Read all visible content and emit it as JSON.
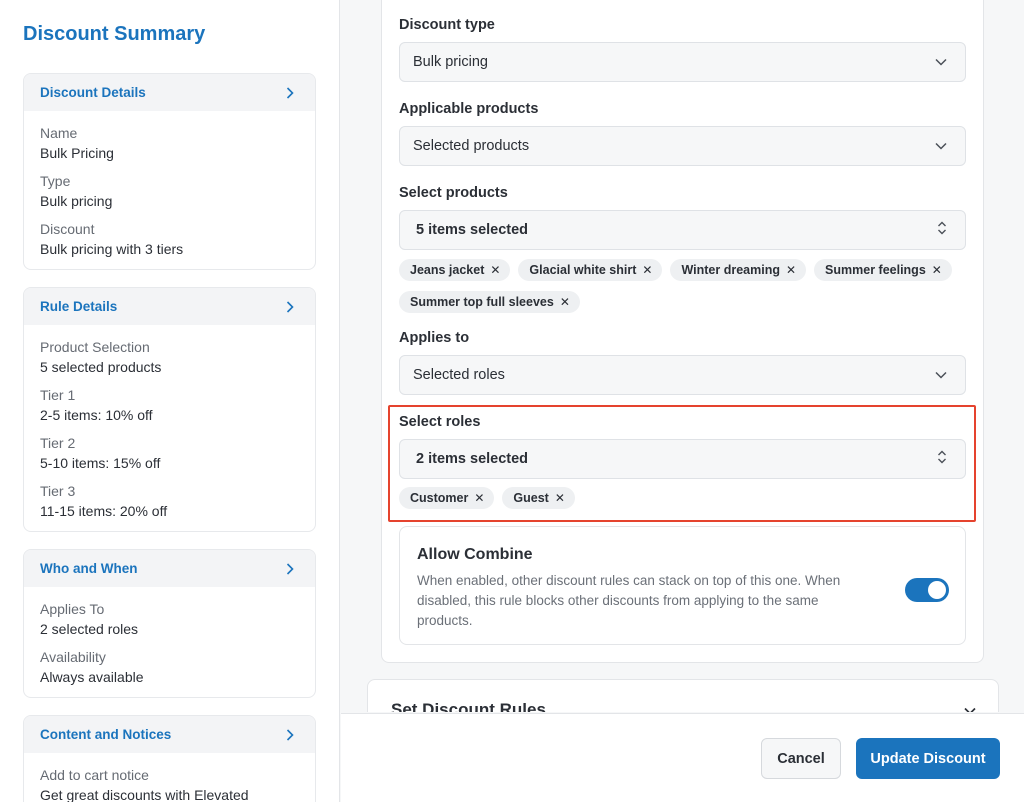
{
  "sidebar": {
    "title": "Discount Summary",
    "cards": {
      "details": {
        "heading": "Discount Details",
        "fields": [
          {
            "label": "Name",
            "value": "Bulk Pricing"
          },
          {
            "label": "Type",
            "value": "Bulk pricing"
          },
          {
            "label": "Discount",
            "value": "Bulk pricing with 3 tiers"
          }
        ]
      },
      "rules": {
        "heading": "Rule Details",
        "fields": [
          {
            "label": "Product Selection",
            "value": "5 selected products"
          },
          {
            "label": "Tier 1",
            "value": "2-5 items: 10% off"
          },
          {
            "label": "Tier 2",
            "value": "5-10 items: 15% off"
          },
          {
            "label": "Tier 3",
            "value": "11-15 items: 20% off"
          }
        ]
      },
      "who": {
        "heading": "Who and When",
        "fields": [
          {
            "label": "Applies To",
            "value": "2 selected roles"
          },
          {
            "label": "Availability",
            "value": "Always available"
          }
        ]
      },
      "content": {
        "heading": "Content and Notices",
        "fields": [
          {
            "label": "Add to cart notice",
            "value": "Get great discounts with Elevated"
          }
        ]
      }
    }
  },
  "form": {
    "discount_type": {
      "label": "Discount type",
      "value": "Bulk pricing"
    },
    "applicable_products": {
      "label": "Applicable products",
      "value": "Selected products"
    },
    "select_products": {
      "label": "Select products",
      "value": "5 items selected",
      "chips": [
        "Jeans jacket",
        "Glacial white shirt",
        "Winter dreaming",
        "Summer feelings",
        "Summer top full sleeves"
      ]
    },
    "applies_to": {
      "label": "Applies to",
      "value": "Selected roles"
    },
    "select_roles": {
      "label": "Select roles",
      "value": "2 items selected",
      "chips": [
        "Customer",
        "Guest"
      ]
    },
    "allow_combine": {
      "title": "Allow Combine",
      "description": "When enabled, other discount rules can stack on top of this one. When disabled, this rule blocks other discounts from applying to the same products.",
      "enabled": true
    },
    "next_section": {
      "title": "Set Discount Rules"
    }
  },
  "footer": {
    "cancel_label": "Cancel",
    "update_label": "Update Discount"
  },
  "colors": {
    "accent": "#1b74bd",
    "highlight": "#e5432e"
  }
}
